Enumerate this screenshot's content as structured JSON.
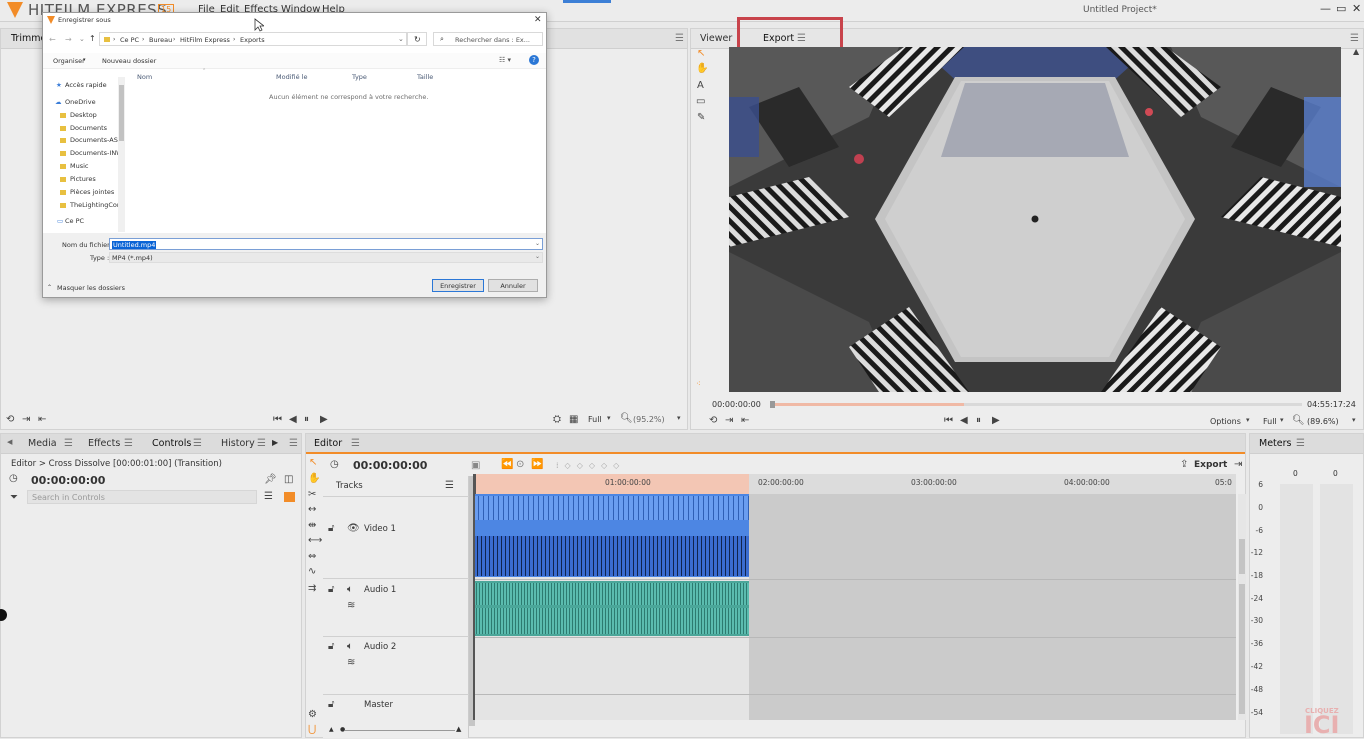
{
  "app": {
    "logo_text": "HITFILM EXPRESS",
    "logo_badge": "15",
    "project_title": "Untitled Project*"
  },
  "menu": [
    "File",
    "Edit",
    "Effects",
    "Window",
    "Help"
  ],
  "trimmer": {
    "tab": "Trimme"
  },
  "dialog": {
    "title": "Enregistrer sous",
    "path": [
      "Ce PC",
      "Bureau",
      "HitFilm Express",
      "Exports"
    ],
    "search_placeholder": "Rechercher dans : Ex...",
    "organize": "Organiser",
    "new_folder": "Nouveau dossier",
    "columns": [
      "Nom",
      "Modifié le",
      "Type",
      "Taille"
    ],
    "empty_msg": "Aucun élément ne correspond à votre recherche.",
    "nav": [
      "Accès rapide",
      "OneDrive",
      "Desktop",
      "Documents",
      "Documents-ASU",
      "Documents-INW",
      "Music",
      "Pictures",
      "Pièces jointes",
      "TheLightingCont",
      "Ce PC"
    ],
    "filename_label": "Nom du fichier :",
    "filename_value": "Untitled.mp4",
    "type_label": "Type :",
    "type_value": "MP4 (*.mp4)",
    "hide_folders": "Masquer les dossiers",
    "save": "Enregistrer",
    "cancel": "Annuler"
  },
  "viewer": {
    "tab_viewer": "Viewer",
    "tab_export": "Export",
    "time_start": "00:00:00:00",
    "time_end": "04:55:17:24",
    "options": "Options",
    "quality": "Full",
    "zoom": "(89.6%)"
  },
  "trimmer_controls": {
    "quality": "Full",
    "zoom": "(95.2%)"
  },
  "left_panel": {
    "tabs": [
      "Media",
      "Effects",
      "Controls",
      "History"
    ],
    "breadcrumb": "Editor > Cross Dissolve [00:00:01:00] (Transition)",
    "time": "00:00:00:00",
    "search_placeholder": "Search in Controls"
  },
  "editor": {
    "tab": "Editor",
    "time": "00:00:00:00",
    "export": "Export",
    "tracks_label": "Tracks",
    "ruler": [
      "01:00:00:00",
      "02:00:00:00",
      "03:00:00:00",
      "04:00:00:00",
      "05:0"
    ],
    "tracks": [
      "Video 1",
      "Audio 1",
      "Audio 2",
      "Master"
    ]
  },
  "meters": {
    "tab": "Meters",
    "channels": [
      "0",
      "0"
    ],
    "scale": [
      "6",
      "0",
      "-6",
      "-12",
      "-18",
      "-24",
      "-30",
      "-36",
      "-42",
      "-48",
      "-54"
    ]
  },
  "watermark": {
    "line1": "CLIQUEZ",
    "line2": "ICI"
  },
  "colors": {
    "accent": "#f28c28",
    "highlight": "#c8434b",
    "video_clip": "#4d86e3",
    "audio_clip": "#4aa699"
  }
}
